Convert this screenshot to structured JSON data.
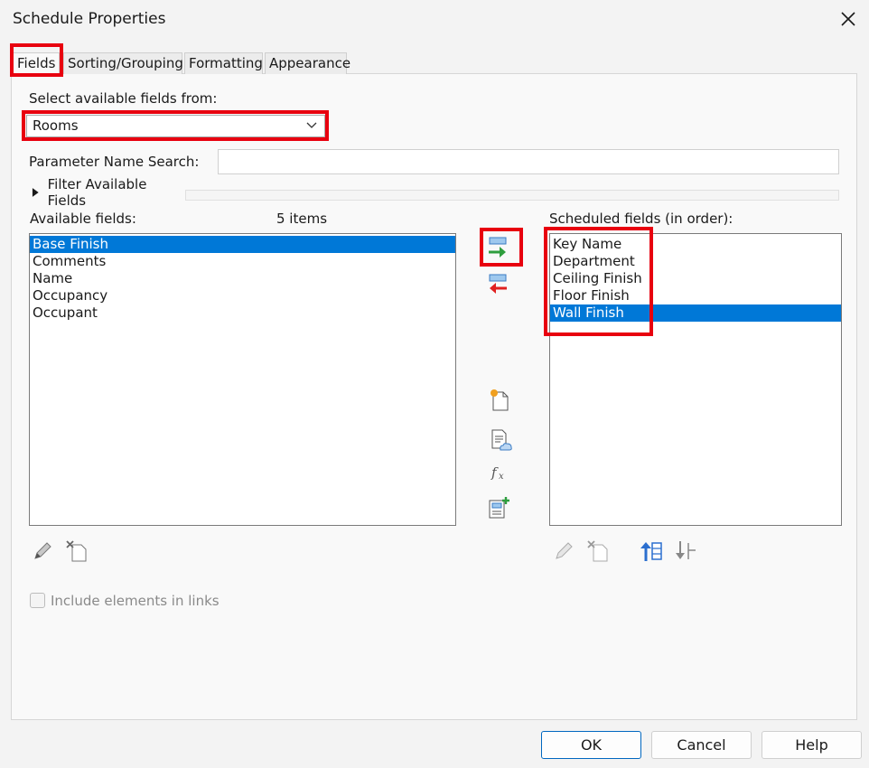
{
  "window": {
    "title": "Schedule Properties"
  },
  "tabs": [
    "Fields",
    "Sorting/Grouping",
    "Formatting",
    "Appearance"
  ],
  "fields": {
    "select_from_label": "Select available fields from:",
    "category_value": "Rooms",
    "param_search_label": "Parameter Name Search:",
    "param_search_value": "",
    "filter_label": "Filter Available Fields",
    "available_label": "Available fields:",
    "available_count": "5 items",
    "available_items": [
      "Base Finish",
      "Comments",
      "Name",
      "Occupancy",
      "Occupant"
    ],
    "available_selected_index": 0,
    "scheduled_label": "Scheduled fields (in order):",
    "scheduled_items": [
      "Key Name",
      "Department",
      "Ceiling Finish",
      "Floor Finish",
      "Wall Finish"
    ],
    "scheduled_selected_index": 4,
    "include_links_label": "Include elements in links",
    "include_links_checked": false
  },
  "footer": {
    "ok": "OK",
    "cancel": "Cancel",
    "help": "Help"
  },
  "colors": {
    "highlight": "#e8000f",
    "selection": "#0078d7",
    "arrow_green": "#2e9e3e",
    "arrow_red": "#e02020"
  }
}
